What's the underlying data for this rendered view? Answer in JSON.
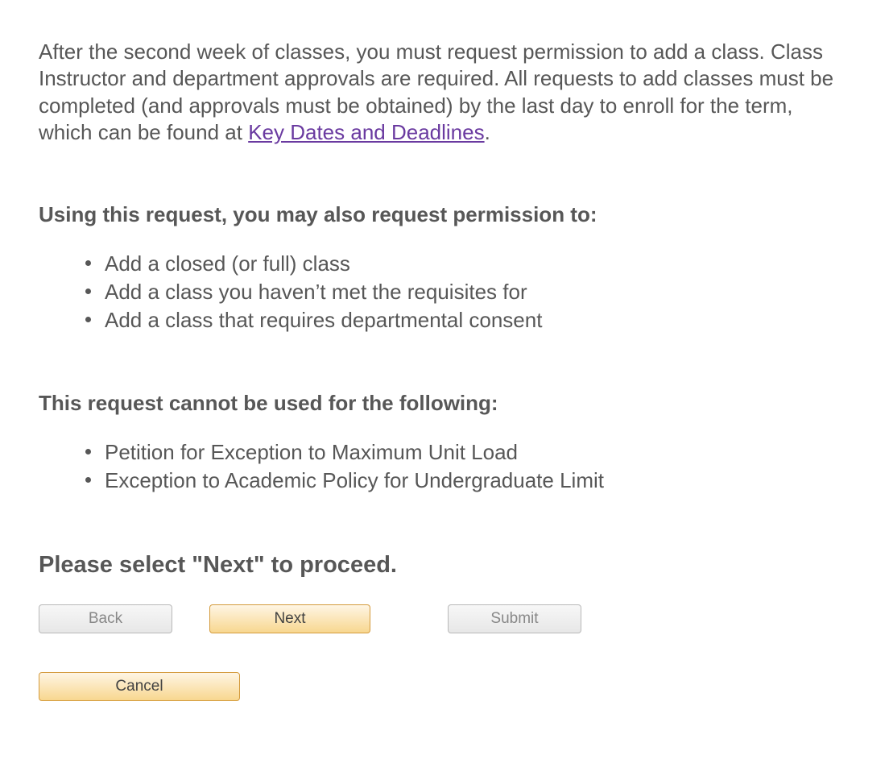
{
  "intro": {
    "text_before_link": "After the second week of classes, you must request permission to add a class. Class Instructor and department approvals are required. All requests to add classes must be completed (and approvals must be obtained) by the last day to enroll for the term, which can be found at ",
    "link_text": "Key Dates and Deadlines",
    "text_after_link": "."
  },
  "may_also": {
    "heading": "Using this request, you may also request permission to:",
    "items": [
      "Add a closed (or full) class",
      "Add a class you haven’t met the requisites for",
      "Add a class that requires departmental consent"
    ]
  },
  "cannot_use": {
    "heading": "This request cannot be used for the following:",
    "items": [
      "Petition for Exception to Maximum Unit Load",
      "Exception to Academic Policy for Undergraduate Limit"
    ]
  },
  "proceed_heading": "Please select \"Next\" to proceed.",
  "buttons": {
    "back": "Back",
    "next": "Next",
    "submit": "Submit",
    "cancel": "Cancel"
  }
}
